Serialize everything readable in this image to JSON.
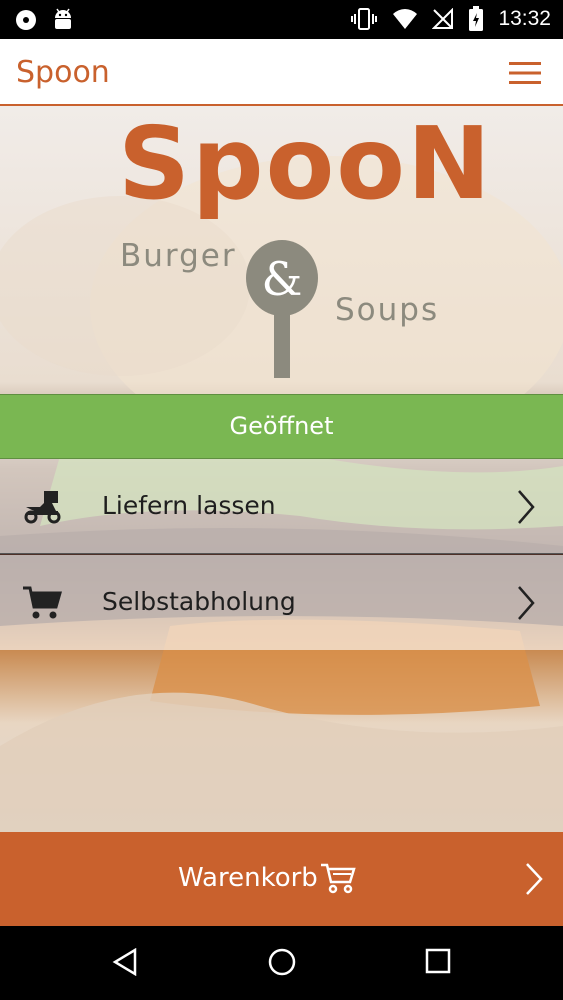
{
  "status_bar": {
    "time": "13:32",
    "left_icons": [
      "disc-icon",
      "android-icon"
    ],
    "right_icons": [
      "vibrate-icon",
      "wifi-icon",
      "no-signal-icon",
      "battery-charging-icon"
    ]
  },
  "app_bar": {
    "title": "Spoon",
    "menu_icon": "hamburger-menu-icon"
  },
  "logo": {
    "brand": "SpooN",
    "left_text": "Burger",
    "middle_glyph": "&",
    "right_text": "Soups"
  },
  "status_banner": {
    "text": "Geöffnet",
    "color": "#7ab752"
  },
  "options": [
    {
      "label": "Liefern lassen",
      "icon": "delivery-scooter-icon"
    },
    {
      "label": "Selbstabholung",
      "icon": "shopping-cart-icon"
    }
  ],
  "cart_bar": {
    "label": "Warenkorb",
    "icon": "cart-outline-icon",
    "color": "#c9612d"
  },
  "nav_bar": {
    "buttons": [
      "back-icon",
      "home-icon",
      "recents-icon"
    ]
  },
  "colors": {
    "accent": "#c9612d",
    "open": "#7ab752"
  }
}
